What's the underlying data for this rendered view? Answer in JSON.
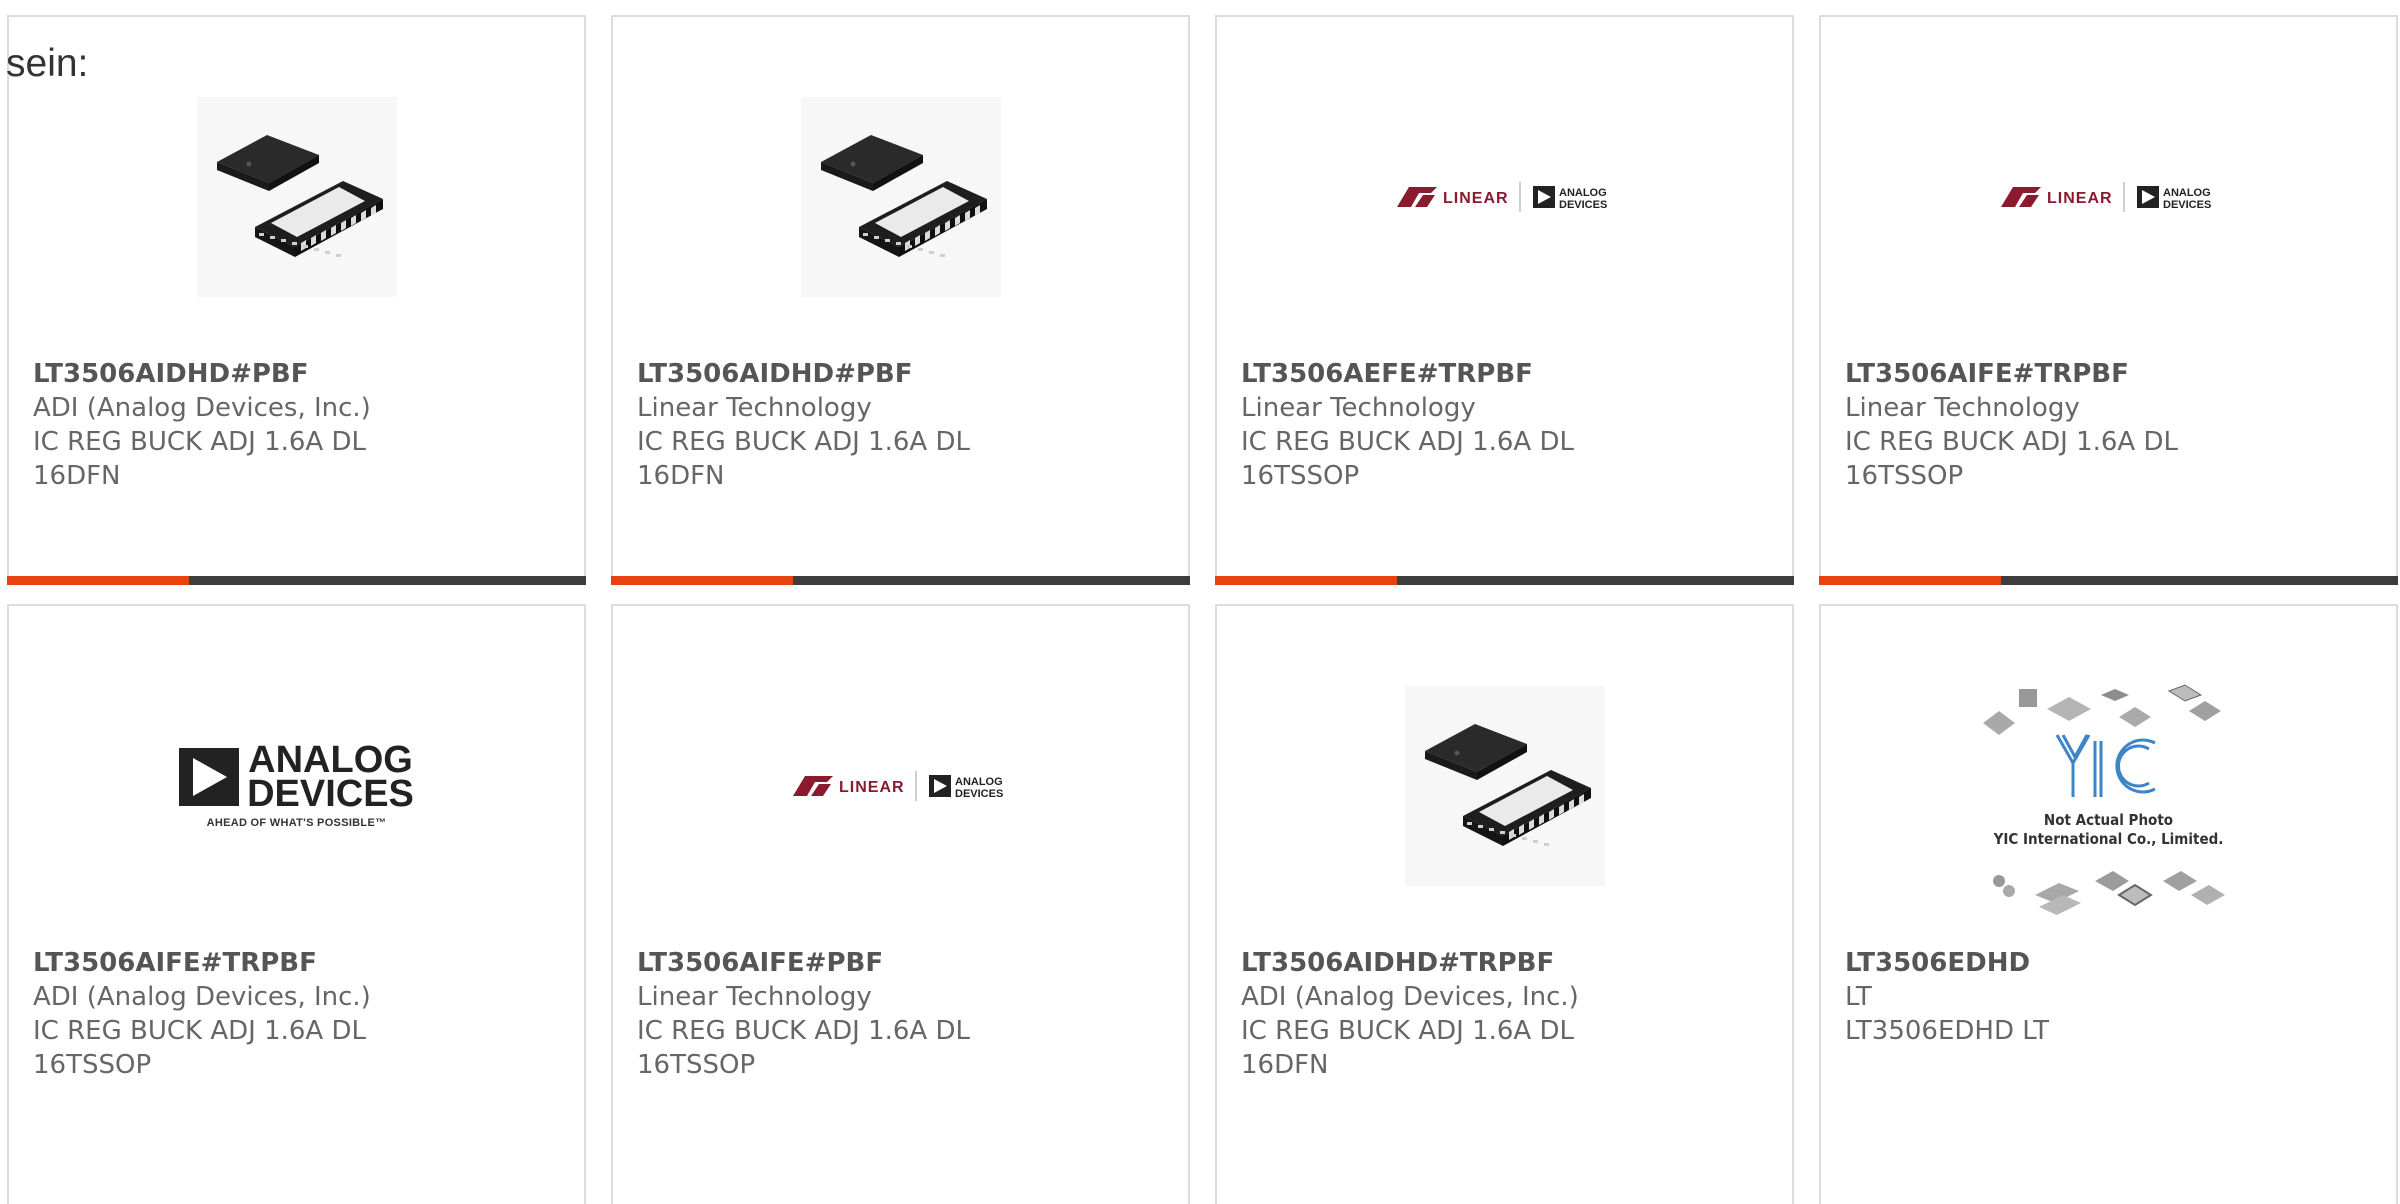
{
  "intro_text": "sein:",
  "accent_color": "#e8420e",
  "products": [
    {
      "part": "LT3506AIDHD#PBF",
      "maker": "ADI (Analog Devices, Inc.)",
      "desc_lines": [
        "IC REG BUCK ADJ 1.6A DL 16DFN"
      ],
      "image": "chip-photo",
      "accent": true
    },
    {
      "part": "LT3506AIDHD#PBF",
      "maker": "Linear Technology",
      "desc_lines": [
        "IC REG BUCK ADJ 1.6A DL 16DFN"
      ],
      "image": "chip-photo",
      "accent": true
    },
    {
      "part": "LT3506AEFE#TRPBF",
      "maker": "Linear Technology",
      "desc_lines": [
        "IC REG BUCK ADJ 1.6A DL",
        "16TSSOP"
      ],
      "image": "lt-adi-logo",
      "accent": true
    },
    {
      "part": "LT3506AIFE#TRPBF",
      "maker": "Linear Technology",
      "desc_lines": [
        "IC REG BUCK ADJ 1.6A DL",
        "16TSSOP"
      ],
      "image": "lt-adi-logo",
      "accent": true
    },
    {
      "part": "LT3506AIFE#TRPBF",
      "maker": "ADI (Analog Devices, Inc.)",
      "desc_lines": [
        "IC REG BUCK ADJ 1.6A DL",
        "16TSSOP"
      ],
      "image": "adi-logo",
      "accent": false
    },
    {
      "part": "LT3506AIFE#PBF",
      "maker": "Linear Technology",
      "desc_lines": [
        "IC REG BUCK ADJ 1.6A DL",
        "16TSSOP"
      ],
      "image": "lt-adi-logo",
      "accent": false
    },
    {
      "part": "LT3506AIDHD#TRPBF",
      "maker": "ADI (Analog Devices, Inc.)",
      "desc_lines": [
        "IC REG BUCK ADJ 1.6A DL 16DFN"
      ],
      "image": "chip-photo",
      "accent": false
    },
    {
      "part": "LT3506EDHD",
      "maker": "LT",
      "desc_lines": [
        "LT3506EDHD LT"
      ],
      "image": "yic-placeholder",
      "accent": false
    }
  ],
  "logos": {
    "adi_line1": "ANALOG",
    "adi_line2": "DEVICES",
    "adi_tagline": "AHEAD OF WHAT'S POSSIBLE™",
    "yic_line1": "Not Actual Photo",
    "yic_line2": "YIC International Co., Limited."
  }
}
